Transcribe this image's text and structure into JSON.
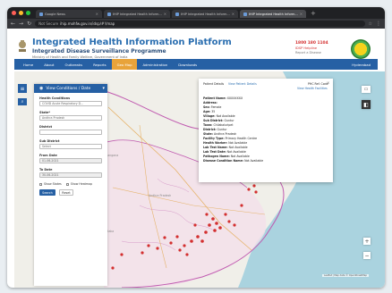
{
  "browser": {
    "tabs": [
      {
        "label": "Google News",
        "active": false
      },
      {
        "label": "IHIP Integrated Health Inform...",
        "active": false
      },
      {
        "label": "IHIP Integrated Health Inform...",
        "active": false
      },
      {
        "label": "IHIP Integrated Health Inform...",
        "active": true
      }
    ],
    "new_tab": "+",
    "url_security": "Not Secure",
    "url": "ihip.mohfw.gov.in/idsp/#!/map"
  },
  "header": {
    "title": "Integrated Health Information Platform",
    "subtitle": "Integrated Disease Surveillance Programme",
    "ministry": "Ministry of Health and Family Welfare, Government of India",
    "helpline_number": "1800 180 1104",
    "helpline_label": "IDSP Helpline",
    "helpline_sub": "Report a Disease"
  },
  "nav": {
    "items": [
      "Home",
      "About",
      "Outbreaks",
      "Reports",
      "Geo Map",
      "Administration",
      "Downloads"
    ],
    "active": "Geo Map",
    "right": "Hyderabad"
  },
  "panel": {
    "title": "View Conditions / Date",
    "fields": [
      {
        "label": "Health Conditions",
        "value": "COVID Acute Respiratory D..."
      },
      {
        "label": "State*",
        "value": "Andhra Pradesh"
      },
      {
        "label": "District",
        "value": ""
      },
      {
        "label": "Sub District",
        "value": "Select"
      },
      {
        "label": "From Date",
        "value": "01-06-2021"
      },
      {
        "label": "To Date",
        "value": "30-06-2021"
      }
    ],
    "show_states": "Show States",
    "show_heatmap": "Show Heatmap",
    "search": "Search",
    "reset": "Reset"
  },
  "popup": {
    "header_left": "Patient Details",
    "header_link": "View Patient Details",
    "header_right": "PHC Ref. Code",
    "header_right_link": "View Health Facilities",
    "lines": [
      {
        "label": "Patient Name:",
        "value": "XXXXXXXX"
      },
      {
        "label": "Address:",
        "value": ""
      },
      {
        "label": "Sex:",
        "value": "Female"
      },
      {
        "label": "Age:",
        "value": "35"
      },
      {
        "label": "Village:",
        "value": "Not Available"
      },
      {
        "label": "Sub District:",
        "value": "Guntur"
      },
      {
        "label": "Town:",
        "value": "Chilakaluripet"
      },
      {
        "label": "District:",
        "value": "Guntur"
      },
      {
        "label": "State:",
        "value": "Andhra Pradesh"
      },
      {
        "label": "Facility Type:",
        "value": "Primary Health Centre"
      },
      {
        "label": "Health Worker:",
        "value": "Not Available"
      },
      {
        "label": "Lab Test Name:",
        "value": "Not Available"
      },
      {
        "label": "Lab Test Date:",
        "value": "Not Available"
      },
      {
        "label": "Pathogen Name:",
        "value": "Not Available"
      },
      {
        "label": "Disease Condition Name:",
        "value": "Not Available"
      }
    ]
  },
  "map": {
    "labels": [
      "Andhra Pradesh",
      "Telangana",
      "Karnataka",
      "Odisha"
    ],
    "attribution": "Leaflet | Map data © OpenStreetMap",
    "zoom_in": "+",
    "zoom_out": "−"
  },
  "colors": {
    "nav_blue": "#2660a4",
    "active_orange": "#e8a33a",
    "marker_red": "#d32f2f",
    "state_border": "#c05bb0"
  }
}
